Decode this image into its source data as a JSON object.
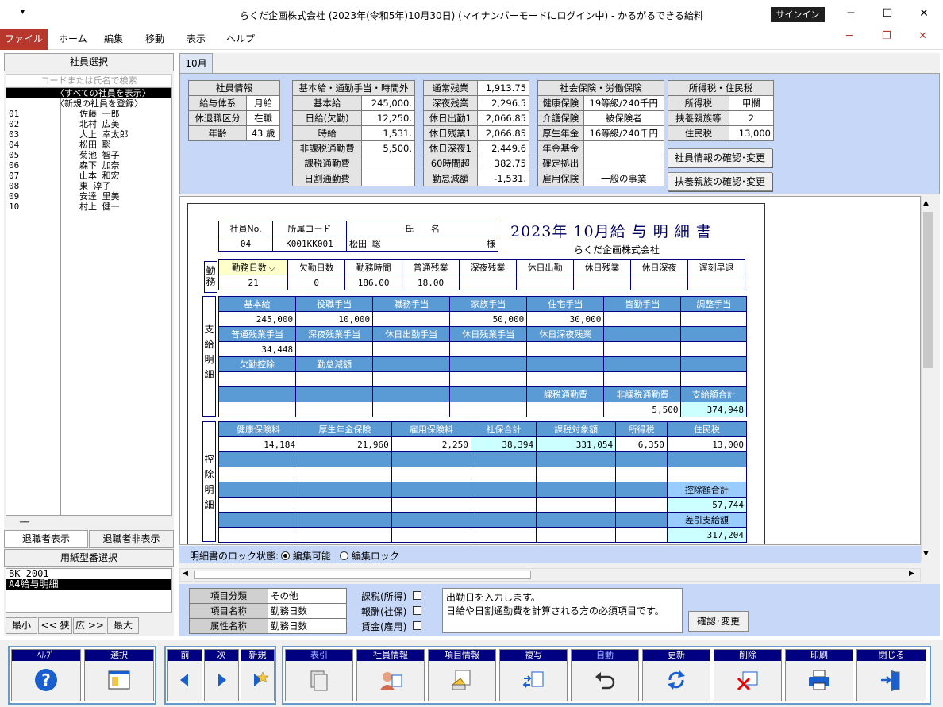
{
  "window": {
    "title": "らくだ企画株式会社 (2023年(令和5年)10月30日) (マイナンバーモードにログイン中)  -  かるがるできる給料",
    "signin": "サインイン",
    "quick": "▾",
    "min": "─",
    "max": "☐",
    "close": "✕",
    "mdi_min": "─",
    "mdi_restore": "❐",
    "mdi_close": "✕"
  },
  "menu": {
    "file": "ファイル",
    "home": "ホーム",
    "edit": "編集",
    "move": "移動",
    "view": "表示",
    "help": "ヘルプ"
  },
  "left": {
    "header": "社員選択",
    "search_placeholder": "コードまたは氏名で検索",
    "employees": [
      {
        "code": "",
        "name": "〈すべての社員を表示〉"
      },
      {
        "code": "",
        "name": "〈新規の社員を登録〉"
      },
      {
        "code": "01",
        "name": "佐藤 一郎"
      },
      {
        "code": "02",
        "name": "北村 広美"
      },
      {
        "code": "03",
        "name": "大上 幸太郎"
      },
      {
        "code": "04",
        "name": "松田 聡"
      },
      {
        "code": "05",
        "name": "菊池 智子"
      },
      {
        "code": "06",
        "name": "森下 加奈"
      },
      {
        "code": "07",
        "name": "山本 和宏"
      },
      {
        "code": "08",
        "name": "東 淳子"
      },
      {
        "code": "09",
        "name": "安達 里美"
      },
      {
        "code": "10",
        "name": "村上 健一"
      }
    ],
    "splitter": "━━",
    "show_retired": "退職者表示",
    "hide_retired": "退職者非表示",
    "paper_header": "用紙型番選択",
    "papers": [
      "BK-2001",
      "A4給与明細"
    ],
    "zoom": [
      "最小",
      "<< 狭",
      "広 >>",
      "最大"
    ]
  },
  "tab": "10月",
  "info": {
    "emp": {
      "title": "社員情報",
      "rows": [
        [
          "給与体系",
          "月給"
        ],
        [
          "休退職区分",
          "在職"
        ],
        [
          "年齢",
          "43 歳"
        ]
      ]
    },
    "pay": {
      "title": "基本給・通勤手当・時間外",
      "rows": [
        [
          "基本給",
          "245,000."
        ],
        [
          "日給(欠勤)",
          "12,250."
        ],
        [
          "時給",
          "1,531."
        ],
        [
          "非課税通勤費",
          "5,500."
        ],
        [
          "課税通勤費",
          ""
        ],
        [
          "日割通勤費",
          ""
        ]
      ]
    },
    "ot": {
      "rows": [
        [
          "通常残業",
          "1,913.75"
        ],
        [
          "深夜残業",
          "2,296.5"
        ],
        [
          "休日出勤1",
          "2,066.85"
        ],
        [
          "休日残業1",
          "2,066.85"
        ],
        [
          "休日深夜1",
          "2,449.6"
        ],
        [
          "60時間超",
          "382.75"
        ],
        [
          "勤怠減額",
          "-1,531."
        ]
      ]
    },
    "ins": {
      "title": "社会保険・労働保険",
      "rows": [
        [
          "健康保険",
          "19等級/240千円"
        ],
        [
          "介護保険",
          "被保険者"
        ],
        [
          "厚生年金",
          "16等級/240千円"
        ],
        [
          "年金基金",
          ""
        ],
        [
          "確定拠出",
          ""
        ],
        [
          "雇用保険",
          "一般の事業"
        ]
      ]
    },
    "tax": {
      "title": "所得税・住民税",
      "rows": [
        [
          "所得税",
          "甲欄"
        ],
        [
          "扶養親族等",
          "2"
        ],
        [
          "住民税",
          "13,000"
        ]
      ]
    },
    "btn_emp": "社員情報の確認･変更",
    "btn_dep": "扶養親族の確認･変更"
  },
  "slip": {
    "h_no": "社員No.",
    "h_dept": "所属コード",
    "h_name": "氏　　名",
    "no": "04",
    "dept": "K001KK001",
    "name": "松田 聡",
    "sama": "様",
    "title": "2023年 10月給 与 明 細 書",
    "company": "らくだ企画株式会社",
    "kinmu_label": "勤務",
    "kinmu_heads": [
      "勤務日数",
      "欠勤日数",
      "勤務時間",
      "普通残業",
      "深夜残業",
      "休日出勤",
      "休日残業",
      "休日深夜",
      "遅刻早退"
    ],
    "kinmu_vals": [
      "21",
      "0",
      "186.00",
      "18.00",
      "",
      "",
      "",
      "",
      ""
    ],
    "shikyu_label": "支給明細",
    "shikyu_h1": [
      "基本給",
      "役職手当",
      "職務手当",
      "家族手当",
      "住宅手当",
      "皆勤手当",
      "調整手当"
    ],
    "shikyu_v1": [
      "245,000",
      "10,000",
      "",
      "50,000",
      "30,000",
      "",
      ""
    ],
    "shikyu_h2": [
      "普通残業手当",
      "深夜残業手当",
      "休日出勤手当",
      "休日残業手当",
      "休日深夜残業",
      "",
      ""
    ],
    "shikyu_v2": [
      "34,448",
      "",
      "",
      "",
      "",
      "",
      ""
    ],
    "shikyu_h3": [
      "欠勤控除",
      "勤怠減額",
      "",
      "",
      "",
      "",
      ""
    ],
    "shikyu_h5": [
      "",
      "",
      "",
      "",
      "課税通勤費",
      "非課税通勤費",
      "支給額合計"
    ],
    "shikyu_v5": [
      "",
      "",
      "",
      "",
      "",
      "5,500",
      "374,948"
    ],
    "kojo_label": "控除明細",
    "kojo_h1": [
      "健康保険料",
      "厚生年金保険",
      "雇用保険料",
      "社保合計",
      "課税対象額",
      "所得税",
      "住民税"
    ],
    "kojo_v1": [
      "14,184",
      "21,960",
      "2,250",
      "38,394",
      "331,054",
      "6,350",
      "13,000"
    ],
    "kojo_total_label": "控除額合計",
    "kojo_total": "57,744",
    "net_label": "差引支給額",
    "net": "317,204"
  },
  "lock": {
    "label": "明細書のロック状態:",
    "editable": "編集可能",
    "locked": "編集ロック"
  },
  "prop": {
    "rows": [
      [
        "項目分類",
        "その他"
      ],
      [
        "項目名称",
        "勤務日数"
      ],
      [
        "属性名称",
        "勤務日数"
      ]
    ],
    "checks": [
      "課税(所得)",
      "報酬(社保)",
      "賃金(雇用)"
    ],
    "desc1": "出勤日を入力します。",
    "desc2": "日給や日割通勤費を計算される方の必須項目です。",
    "confirm": "確認･変更"
  },
  "toolbar": {
    "help": "ﾍﾙﾌﾟ",
    "select": "選択",
    "prev": "前",
    "next": "次",
    "new": "新規",
    "index": "表引",
    "empinfo": "社員情報",
    "iteminfo": "項目情報",
    "copy": "複写",
    "auto": "自動",
    "update": "更新",
    "delete": "削除",
    "print": "印刷",
    "close": "閉じる"
  }
}
